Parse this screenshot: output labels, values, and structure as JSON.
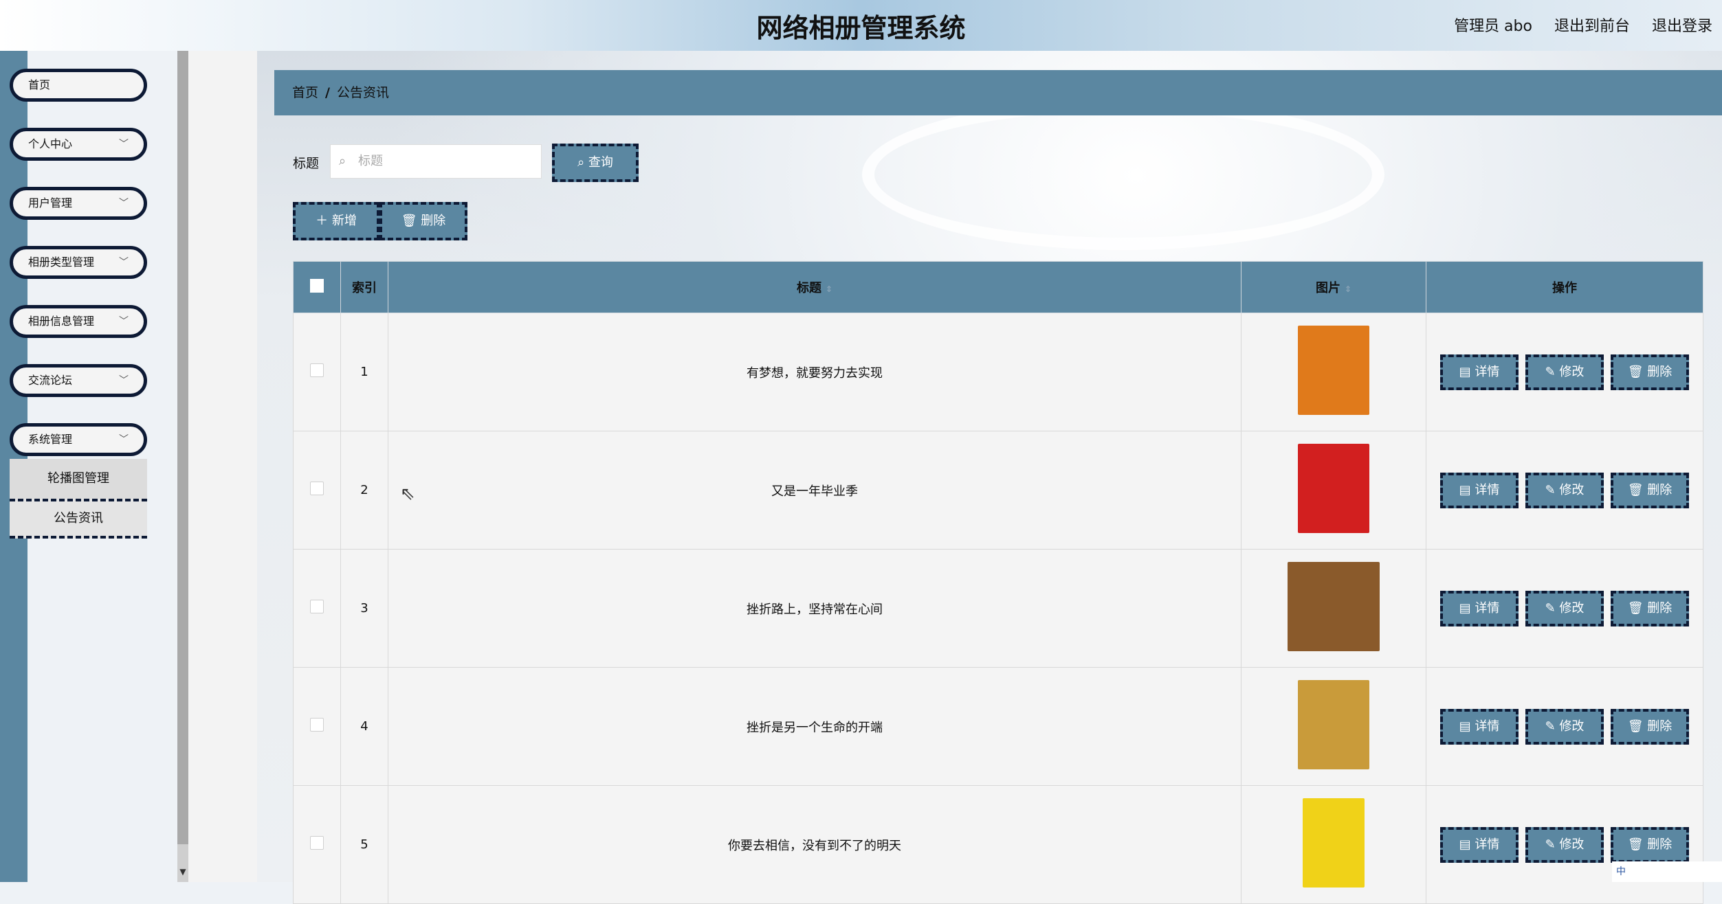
{
  "header": {
    "title": "网络相册管理系统",
    "user": "管理员 abo",
    "front_link": "退出到前台",
    "logout": "退出登录"
  },
  "sidebar": {
    "items": [
      {
        "label": "首页"
      },
      {
        "label": "个人中心"
      },
      {
        "label": "用户管理"
      },
      {
        "label": "相册类型管理"
      },
      {
        "label": "相册信息管理"
      },
      {
        "label": "交流论坛"
      },
      {
        "label": "系统管理"
      }
    ],
    "sub_items": [
      {
        "label": "轮播图管理"
      },
      {
        "label": "公告资讯"
      }
    ]
  },
  "breadcrumb": {
    "home": "首页",
    "sep": "/",
    "current": "公告资讯"
  },
  "search": {
    "label": "标题",
    "placeholder": "标题",
    "query_button": "查询"
  },
  "actions": {
    "add": "新增",
    "delete": "删除"
  },
  "table": {
    "columns": {
      "index": "索引",
      "title": "标题",
      "image": "图片",
      "ops": "操作"
    },
    "rows": [
      {
        "index": "1",
        "title": "有梦想，就要努力去实现",
        "image_color": "#e07a1b"
      },
      {
        "index": "2",
        "title": "又是一年毕业季",
        "image_color": "#d21f1f"
      },
      {
        "index": "3",
        "title": "挫折路上，坚持常在心间",
        "image_color": "#8a5a2b"
      },
      {
        "index": "4",
        "title": "挫折是另一个生命的开端",
        "image_color": "#c99b3a"
      },
      {
        "index": "5",
        "title": "你要去相信，没有到不了的明天",
        "image_color": "#f0d218"
      }
    ],
    "ops": {
      "detail": "详情",
      "edit": "修改",
      "delete": "删除"
    }
  },
  "ime": "中"
}
